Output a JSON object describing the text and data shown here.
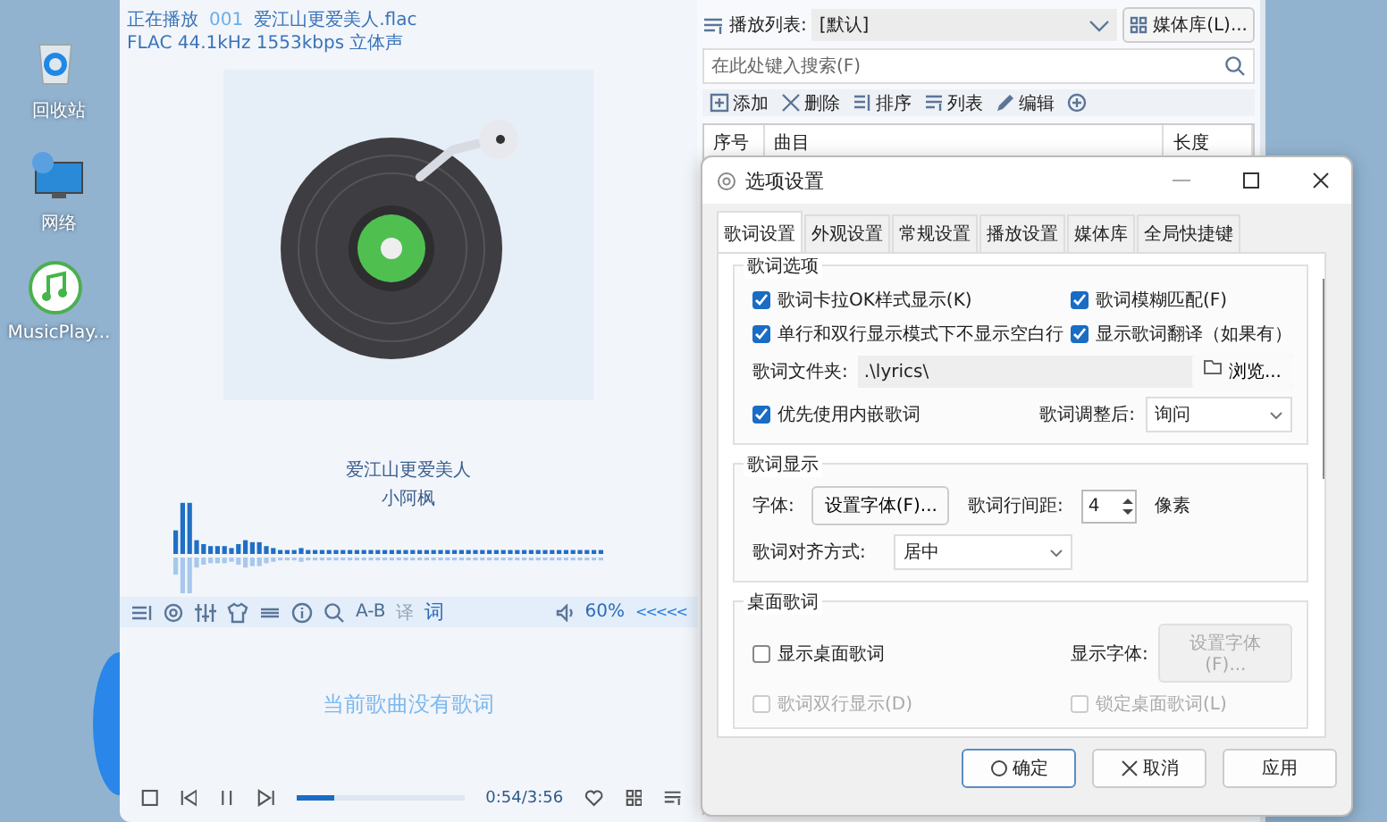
{
  "desktop_icons": [
    {
      "label": "回收站",
      "kind": "recycle"
    },
    {
      "label": "网络",
      "kind": "network"
    },
    {
      "label": "MusicPlay...",
      "kind": "music"
    }
  ],
  "player": {
    "now_playing_label": "正在播放",
    "track_number": "001",
    "file_name": "爱江山更爱美人.flac",
    "format_info": "FLAC 44.1kHz 1553kbps 立体声",
    "song_title": "爱江山更爱美人",
    "artist": "小阿枫",
    "ab_label": "A-B",
    "translate": {
      "label": "译",
      "disabled": true
    },
    "lyrics_toggle": "词",
    "volume": "60%",
    "collapse": "<<<<<",
    "lyrics_placeholder": "当前歌曲没有歌词",
    "progress": {
      "level": 0.23
    },
    "time": "0:54/3:56"
  },
  "playlist": {
    "label": "播放列表:",
    "current": "[默认]",
    "media_library_button": "媒体库(L)...",
    "search": {
      "placeholder": "在此处键入搜索(F)"
    },
    "toolbar": [
      {
        "label": "添加",
        "kind": "add"
      },
      {
        "label": "删除",
        "kind": "delete"
      },
      {
        "label": "排序",
        "kind": "sort"
      },
      {
        "label": "列表",
        "kind": "list"
      },
      {
        "label": "编辑",
        "kind": "edit"
      },
      {
        "kind": "more"
      }
    ],
    "columns": [
      "序号",
      "曲目",
      "长度"
    ]
  },
  "dialog": {
    "title": "选项设置",
    "tabs": [
      {
        "label": "歌词设置",
        "selected": true
      },
      {
        "label": "外观设置",
        "selected": false
      },
      {
        "label": "常规设置",
        "selected": false
      },
      {
        "label": "播放设置",
        "selected": false
      },
      {
        "label": "媒体库",
        "selected": false
      },
      {
        "label": "全局快捷键",
        "selected": false
      }
    ],
    "lyric_options": {
      "title": "歌词选项",
      "checkboxes": [
        {
          "label": "歌词卡拉OK样式显示(K)",
          "checked": true
        },
        {
          "label": "歌词模糊匹配(F)",
          "checked": true
        },
        {
          "label": "单行和双行显示模式下不显示空白行",
          "checked": true
        },
        {
          "label": "显示歌词翻译（如果有）",
          "checked": true
        }
      ],
      "folder_label": "歌词文件夹:",
      "folder_value": ".\\lyrics\\",
      "browse_button": "浏览...",
      "prefer_embedded": {
        "label": "优先使用内嵌歌词",
        "checked": true
      },
      "after_adjust_label": "歌词调整后:",
      "after_adjust_value": "询问"
    },
    "lyric_display": {
      "title": "歌词显示",
      "font_label": "字体:",
      "font_button": "设置字体(F)...",
      "spacing_label": "歌词行间距:",
      "spacing_value": "4",
      "spacing_unit": "像素",
      "align_label": "歌词对齐方式:",
      "align_value": "居中"
    },
    "desktop_lyrics": {
      "title": "桌面歌词",
      "font_label": "显示字体:",
      "font_button": {
        "label": "设置字体(F)...",
        "disabled": true
      },
      "checkboxes": [
        {
          "label": "显示桌面歌词",
          "checked": false,
          "disabled": false
        },
        {
          "label": "歌词双行显示(D)",
          "checked": false,
          "disabled": true
        },
        {
          "label": "锁定桌面歌词(L)",
          "checked": false,
          "disabled": true
        }
      ]
    },
    "buttons": [
      {
        "label": "确定",
        "kind": "ok"
      },
      {
        "label": "取消",
        "kind": "cancel"
      },
      {
        "label": "应用",
        "kind": "apply"
      }
    ]
  }
}
